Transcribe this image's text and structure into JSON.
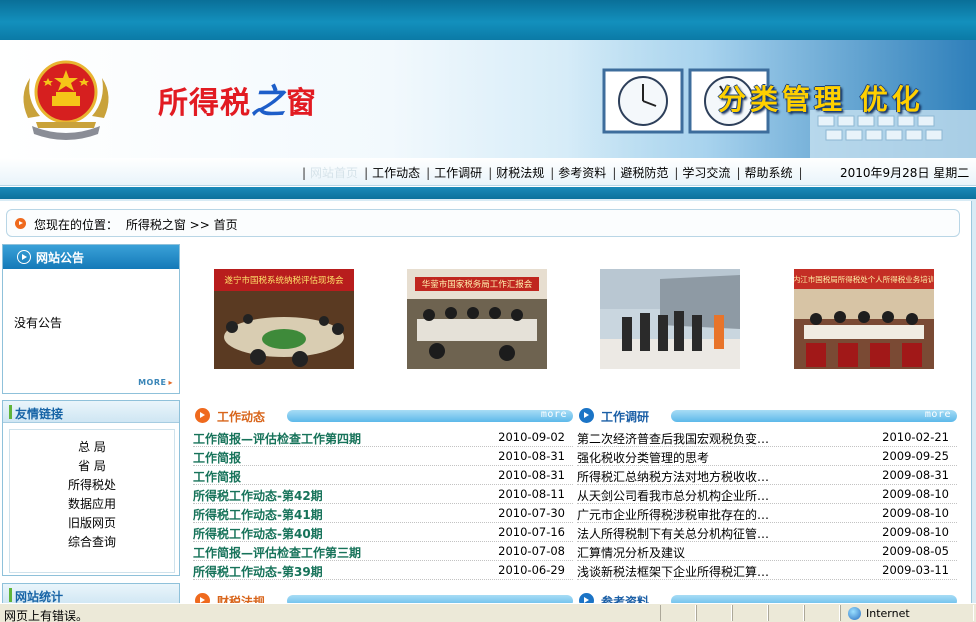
{
  "banner": {
    "site_logo": "所得税之窗",
    "slogan": "分类管理 优化"
  },
  "nav": {
    "items": [
      "网站首页",
      "工作动态",
      "工作调研",
      "财税法规",
      "参考资料",
      "避税防范",
      "学习交流",
      "帮助系统"
    ],
    "date": "2010年9月28日 星期二"
  },
  "breadcrumb": {
    "prefix": "您现在的位置：",
    "path": "所得税之窗 >> 首页"
  },
  "notice_box": {
    "title": "网站公告",
    "content": "没有公告",
    "more": "MORE"
  },
  "links_box": {
    "title": "友情链接",
    "items": [
      "总 局",
      "省 局",
      "所得税处",
      "数据应用",
      "旧版网页",
      "综合查询"
    ]
  },
  "stats_box": {
    "title": "网站统计"
  },
  "photos": [
    {
      "caption": "遂宁市国税系统纳税评估现场会"
    },
    {
      "caption": "华蓥市国家税务局工作汇报会"
    },
    {
      "caption": ""
    },
    {
      "caption": "内江市国税局所得税处个人所得税业务培训"
    }
  ],
  "work_news": {
    "title": "工作动态",
    "more": "more",
    "rows": [
      {
        "title": "工作简报—评估检查工作第四期",
        "date": "2010-09-02"
      },
      {
        "title": "工作简报",
        "date": "2010-08-31"
      },
      {
        "title": "工作简报",
        "date": "2010-08-31"
      },
      {
        "title": "所得税工作动态-第42期",
        "date": "2010-08-11"
      },
      {
        "title": "所得税工作动态-第41期",
        "date": "2010-07-30"
      },
      {
        "title": "所得税工作动态-第40期",
        "date": "2010-07-16"
      },
      {
        "title": "工作简报—评估检查工作第三期",
        "date": "2010-07-08"
      },
      {
        "title": "所得税工作动态-第39期",
        "date": "2010-06-29"
      }
    ]
  },
  "work_research": {
    "title": "工作调研",
    "more": "more",
    "rows": [
      {
        "title": "第二次经济普查后我国宏观税负变…",
        "date": "2010-02-21"
      },
      {
        "title": "强化税收分类管理的思考",
        "date": "2009-09-25"
      },
      {
        "title": "所得税汇总纳税方法对地方税收收…",
        "date": "2009-08-31"
      },
      {
        "title": "从天剑公司看我市总分机构企业所…",
        "date": "2009-08-10"
      },
      {
        "title": "广元市企业所得税涉税审批存在的…",
        "date": "2009-08-10"
      },
      {
        "title": "法人所得税制下有关总分机构征管…",
        "date": "2009-08-10"
      },
      {
        "title": "汇算情况分析及建议",
        "date": "2009-08-05"
      },
      {
        "title": "浅谈新税法框架下企业所得税汇算…",
        "date": "2009-03-11"
      }
    ]
  },
  "lower_sections": {
    "left_title": "财税法规",
    "right_title": "参考资料"
  },
  "statusbar": {
    "message": "网页上有错误。",
    "zone": "Internet"
  },
  "colors": {
    "accent_blue": "#1479b8",
    "left_title_color": "#17735a",
    "section_icon_orange": "#ef6a1e",
    "section_icon_blue": "#1b74c6"
  }
}
